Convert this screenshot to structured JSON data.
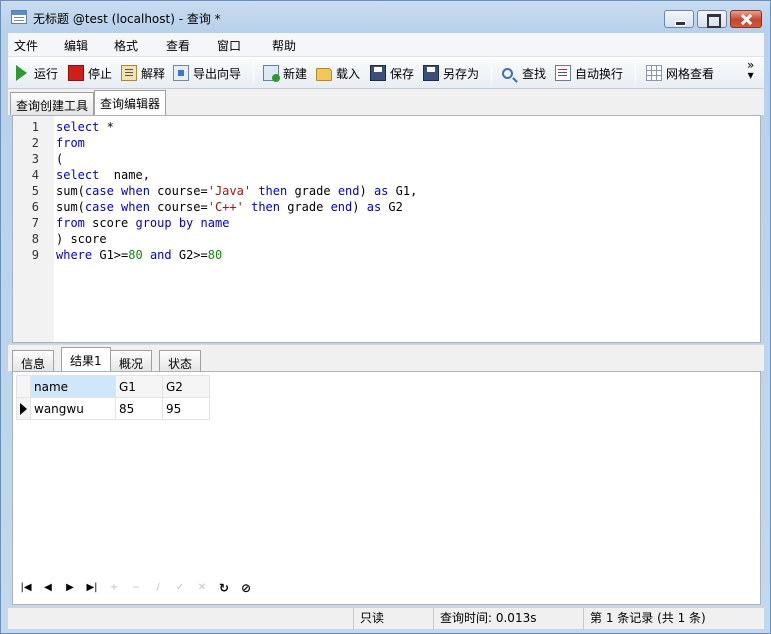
{
  "window": {
    "title": "无标题 @test (localhost) - 查询 *"
  },
  "menu": [
    "文件",
    "编辑",
    "格式",
    "查看",
    "窗口",
    "帮助"
  ],
  "toolbar": {
    "run": "运行",
    "stop": "停止",
    "explain": "解释",
    "export_wizard": "导出向导",
    "new": "新建",
    "load": "载入",
    "save": "保存",
    "save_as": "另存为",
    "find": "查找",
    "word_wrap": "自动换行",
    "grid_view": "网格查看",
    "more": "»"
  },
  "top_tabs": [
    "查询创建工具",
    "查询编辑器"
  ],
  "editor": {
    "lines": [
      [
        {
          "t": "select",
          "c": "kw"
        },
        {
          "t": " *",
          "c": ""
        }
      ],
      [
        {
          "t": "from",
          "c": "kw"
        }
      ],
      [
        {
          "t": "(",
          "c": ""
        }
      ],
      [
        {
          "t": "select",
          "c": "kw"
        },
        {
          "t": "  name,",
          "c": ""
        }
      ],
      [
        {
          "t": "sum(",
          "c": ""
        },
        {
          "t": "case when",
          "c": "kw"
        },
        {
          "t": " course=",
          "c": ""
        },
        {
          "t": "'Java'",
          "c": "str"
        },
        {
          "t": " ",
          "c": ""
        },
        {
          "t": "then",
          "c": "kw"
        },
        {
          "t": " grade ",
          "c": ""
        },
        {
          "t": "end",
          "c": "kw"
        },
        {
          "t": ") ",
          "c": ""
        },
        {
          "t": "as",
          "c": "kw"
        },
        {
          "t": " G1,",
          "c": ""
        }
      ],
      [
        {
          "t": "sum(",
          "c": ""
        },
        {
          "t": "case when",
          "c": "kw"
        },
        {
          "t": " course=",
          "c": ""
        },
        {
          "t": "'C++'",
          "c": "str"
        },
        {
          "t": " ",
          "c": ""
        },
        {
          "t": "then",
          "c": "kw"
        },
        {
          "t": " grade ",
          "c": ""
        },
        {
          "t": "end",
          "c": "kw"
        },
        {
          "t": ") ",
          "c": ""
        },
        {
          "t": "as",
          "c": "kw"
        },
        {
          "t": " G2",
          "c": ""
        }
      ],
      [
        {
          "t": "from",
          "c": "kw"
        },
        {
          "t": " score ",
          "c": ""
        },
        {
          "t": "group by",
          "c": "kw"
        },
        {
          "t": " ",
          "c": ""
        },
        {
          "t": "name",
          "c": "kw"
        }
      ],
      [
        {
          "t": ") score",
          "c": ""
        }
      ],
      [
        {
          "t": "where",
          "c": "kw"
        },
        {
          "t": " G1>=",
          "c": ""
        },
        {
          "t": "80",
          "c": "num"
        },
        {
          "t": " ",
          "c": ""
        },
        {
          "t": "and",
          "c": "kw"
        },
        {
          "t": " G2>=",
          "c": ""
        },
        {
          "t": "80",
          "c": "num"
        }
      ]
    ]
  },
  "result_tabs": [
    "信息",
    "结果1",
    "概况",
    "状态"
  ],
  "result": {
    "columns": [
      "name",
      "G1",
      "G2"
    ],
    "rows": [
      [
        "wangwu",
        "85",
        "95"
      ]
    ]
  },
  "grid_nav": {
    "first": "|◀",
    "prev": "◀",
    "next": "▶",
    "last": "▶|",
    "add": "+",
    "delete": "−",
    "edit": "∕",
    "apply": "✓",
    "cancel": "✕",
    "refresh": "↻",
    "stop": "⊘"
  },
  "status": {
    "readonly": "只读",
    "query_time": "查询时间: 0.013s",
    "records": "第 1 条记录 (共 1 条)"
  }
}
